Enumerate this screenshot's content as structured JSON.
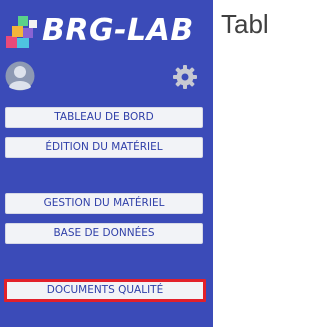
{
  "app": {
    "logo_text": "BRG-LAB",
    "logo_icon": "cube-stack-icon"
  },
  "user": {
    "avatar_icon": "user-avatar-icon",
    "settings_icon": "gear-icon"
  },
  "sidebar": {
    "items": [
      {
        "label": "TABLEAU DE BORD"
      },
      {
        "label": "ÉDITION DU MATÉRIEL"
      },
      {
        "label": "GESTION DU MATÉRIEL"
      },
      {
        "label": "BASE DE DONNÉES"
      },
      {
        "label": "DOCUMENTS QUALITÉ",
        "highlighted": true
      }
    ]
  },
  "main": {
    "title": "Tabl"
  },
  "colors": {
    "sidebar_bg": "#3b4bb8",
    "button_bg": "#f2f3f7",
    "button_text": "#2f3fa8",
    "highlight_border": "#e2202a"
  }
}
